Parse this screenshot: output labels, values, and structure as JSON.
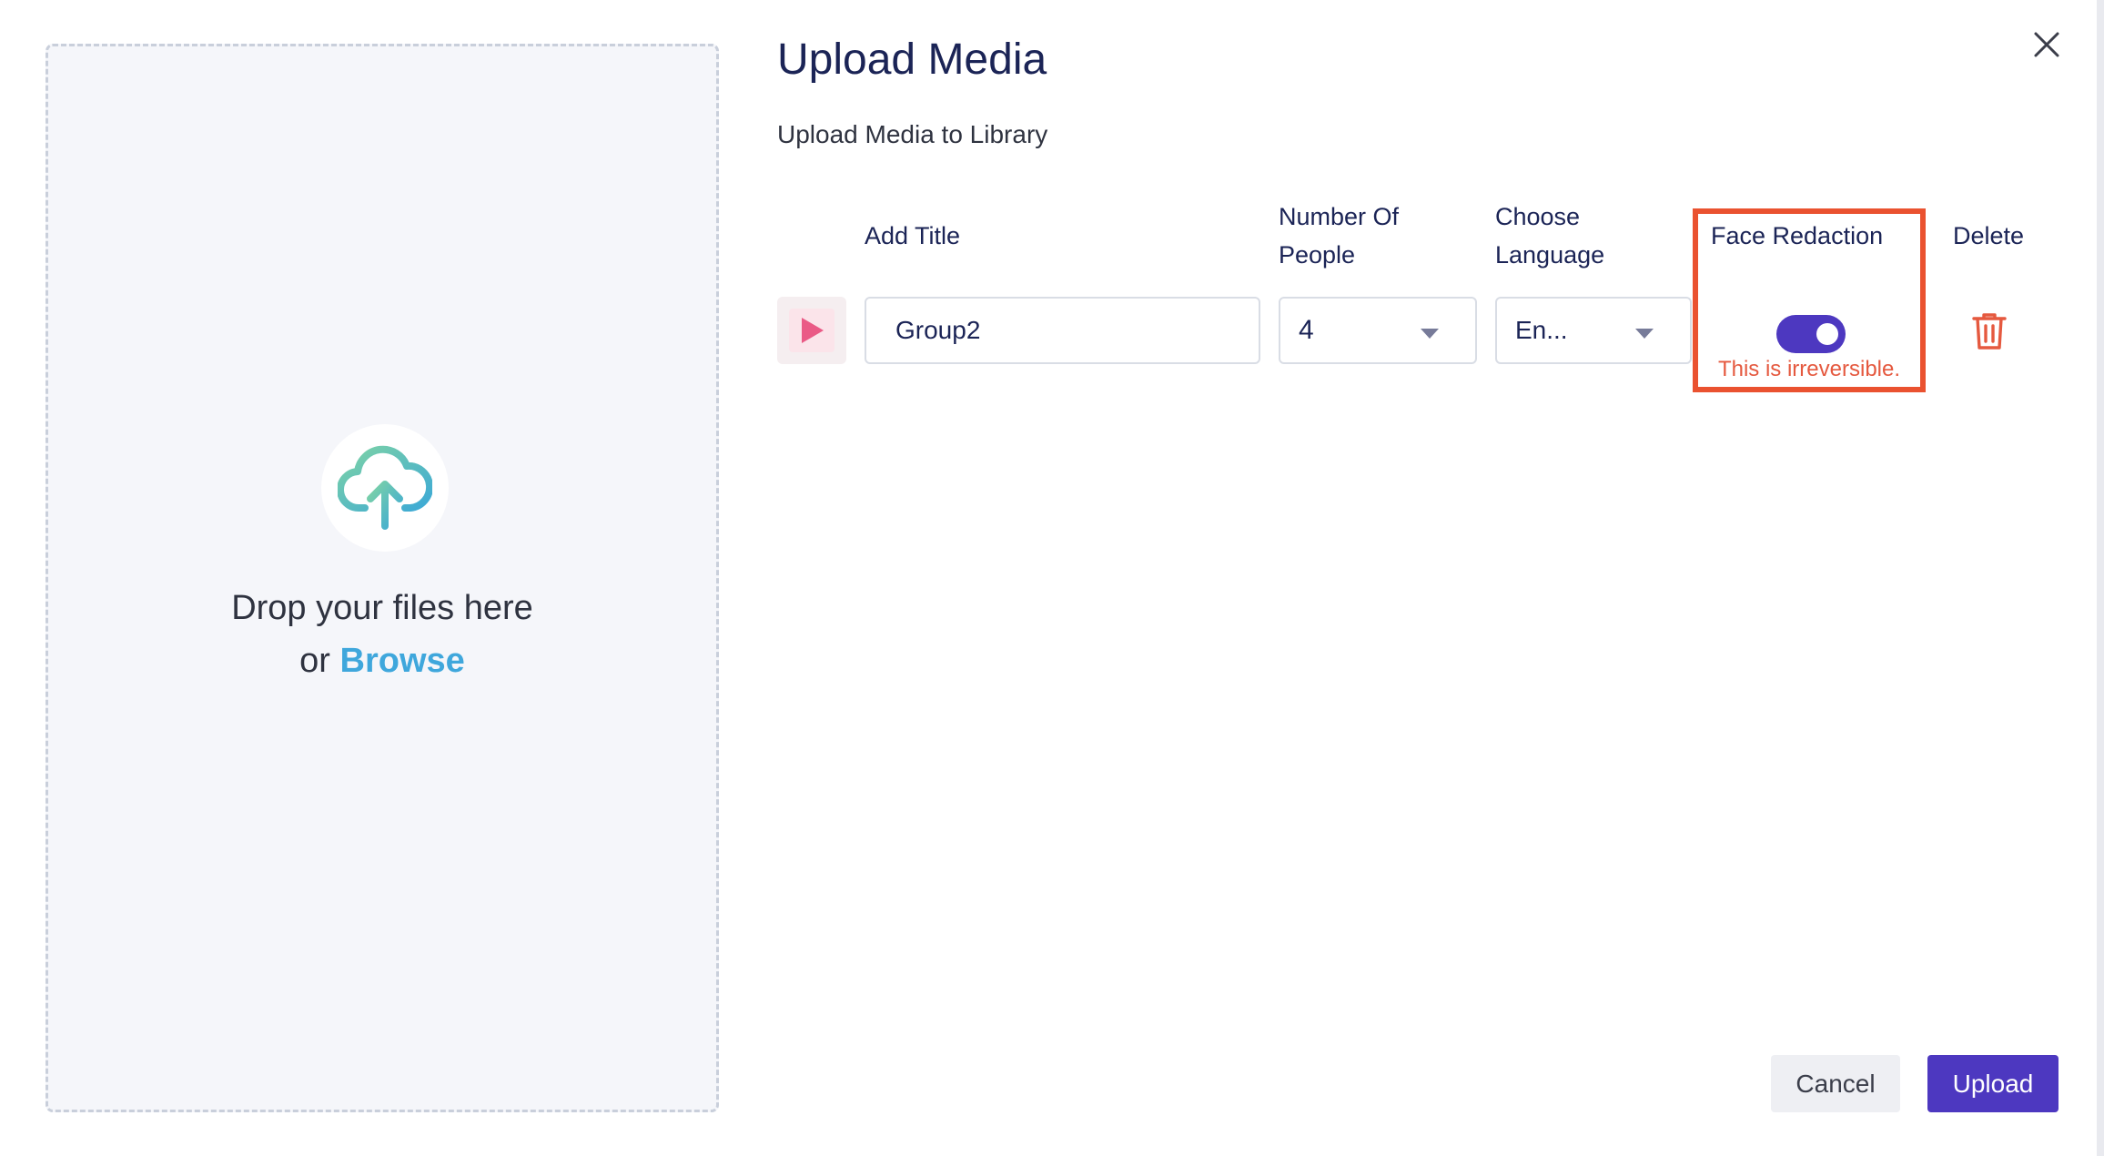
{
  "dialog": {
    "title": "Upload Media",
    "subtitle": "Upload Media to Library",
    "close_icon": "close-icon"
  },
  "dropzone": {
    "line1": "Drop your files here",
    "or_text": "or",
    "browse_label": "Browse",
    "icon": "cloud-upload-icon",
    "icon_colors": [
      "#7ed3a5",
      "#3ca9d6"
    ]
  },
  "columns": {
    "title": "Add Title",
    "people": "Number Of People",
    "people_line1": "Number Of",
    "people_line2": "People",
    "language": "Choose Language",
    "language_line1": "Choose",
    "language_line2": "Language",
    "face_redaction": "Face Redaction",
    "delete": "Delete"
  },
  "media_row": {
    "thumbnail_icon": "play-icon",
    "title_value": "Group2",
    "people_value": "4",
    "language_value": "En...",
    "face_redaction_on": true,
    "face_redaction_warning": "This is irreversible.",
    "delete_icon": "trash-icon"
  },
  "footer": {
    "cancel_label": "Cancel",
    "upload_label": "Upload"
  },
  "colors": {
    "accent": "#4d38c0",
    "title_text": "#1b2456",
    "danger": "#e5593f",
    "highlight_border": "#ea5230",
    "link": "#3fa7dc"
  }
}
